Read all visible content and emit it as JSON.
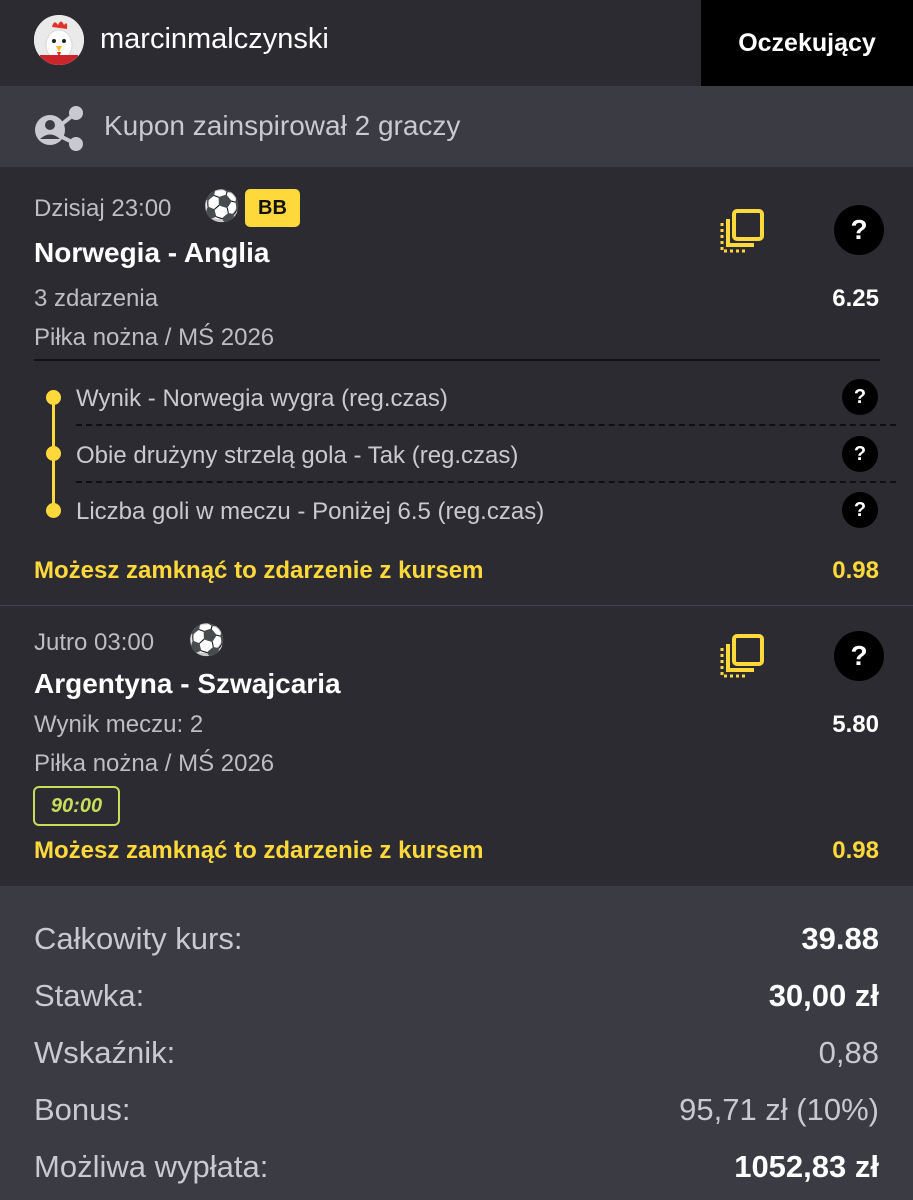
{
  "header": {
    "username": "marcinmalczynski",
    "status_button": "Oczekujący"
  },
  "inspire": {
    "text": "Kupon zainspirował 2 graczy",
    "icon": "share-network-icon"
  },
  "events": [
    {
      "datetime": "Dzisiaj 23:00",
      "sport_icon": "soccer-ball-icon",
      "badge": "BB",
      "teams": "Norwegia - Anglia",
      "market": "3 zdarzenia",
      "odds": "6.25",
      "league": "Piłka nożna / MŚ 2026",
      "selections": [
        "Wynik - Norwegia wygra (reg.czas)",
        "Obie drużyny strzelą gola - Tak (reg.czas)",
        "Liczba goli w meczu - Poniżej 6.5 (reg.czas)"
      ],
      "help": "?",
      "cashout_text": "Możesz zamknąć to zdarzenie z kursem",
      "cashout_odds": "0.98"
    },
    {
      "datetime": "Jutro 03:00",
      "sport_icon": "soccer-ball-icon",
      "teams": "Argentyna - Szwajcaria",
      "market": "Wynik meczu: 2",
      "odds": "5.80",
      "league": "Piłka nożna / MŚ 2026",
      "time_chip": "90:00",
      "help": "?",
      "cashout_text": "Możesz zamknąć to zdarzenie z kursem",
      "cashout_odds": "0.98"
    }
  ],
  "summary": {
    "total_odds_label": "Całkowity kurs:",
    "total_odds": "39.88",
    "stake_label": "Stawka:",
    "stake": "30,00 zł",
    "ratio_label": "Wskaźnik:",
    "ratio": "0,88",
    "bonus_label": "Bonus:",
    "bonus": "95,71 zł (10%)",
    "payout_label": "Możliwa wypłata:",
    "payout": "1052,83 zł"
  },
  "colors": {
    "accent": "#ffd93b",
    "chip": "#c6de5c",
    "background": "#2b2b31",
    "panel": "#3a3b43"
  }
}
